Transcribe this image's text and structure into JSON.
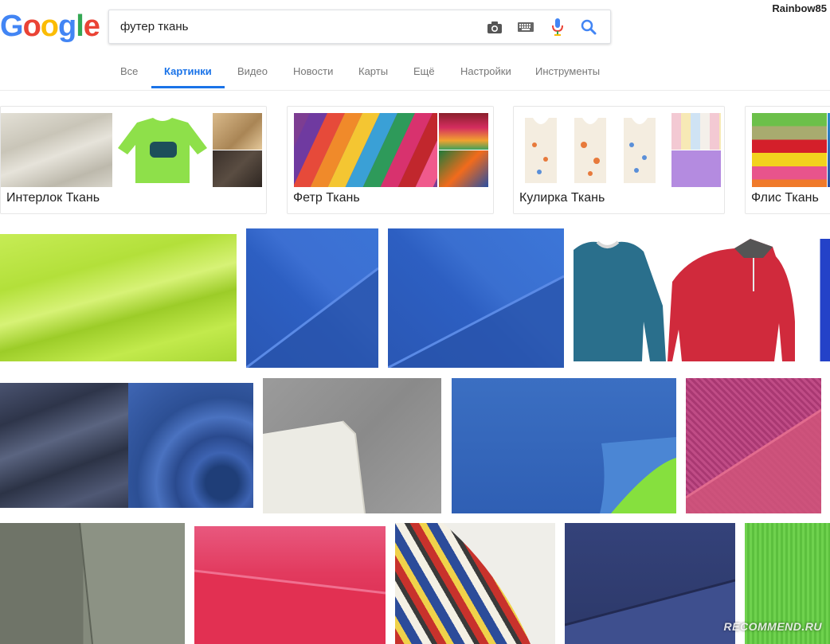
{
  "header": {
    "logo_letters": [
      "G",
      "o",
      "o",
      "g",
      "l",
      "e"
    ],
    "logo_colors": [
      "#4285F4",
      "#EA4335",
      "#FBBC05",
      "#4285F4",
      "#34A853",
      "#EA4335"
    ],
    "query": "футер ткань",
    "username": "Rainbow85",
    "icons": [
      "camera-icon",
      "keyboard-icon",
      "microphone-icon",
      "search-icon"
    ]
  },
  "tabs": [
    {
      "label": "Все"
    },
    {
      "label": "Картинки",
      "active": true
    },
    {
      "label": "Видео"
    },
    {
      "label": "Новости"
    },
    {
      "label": "Карты"
    },
    {
      "label": "Ещё"
    },
    {
      "label": "Настройки"
    },
    {
      "label": "Инструменты"
    }
  ],
  "related": [
    {
      "label": "Интерлок Ткань"
    },
    {
      "label": "Фетр Ткань"
    },
    {
      "label": "Кулирка Ткань"
    },
    {
      "label": "Флис Ткань"
    }
  ],
  "colors": {
    "accent": "#1a73e8",
    "lime": "#b6e03a",
    "royal_blue": "#2f5fbf",
    "teal": "#2a6f8c",
    "red": "#d02a3c",
    "navy": "#33405c",
    "gray": "#8b8b8b",
    "magenta": "#b8417a",
    "pink": "#e03058",
    "green": "#6ad04a"
  },
  "watermark": "RECOMMEND.RU"
}
